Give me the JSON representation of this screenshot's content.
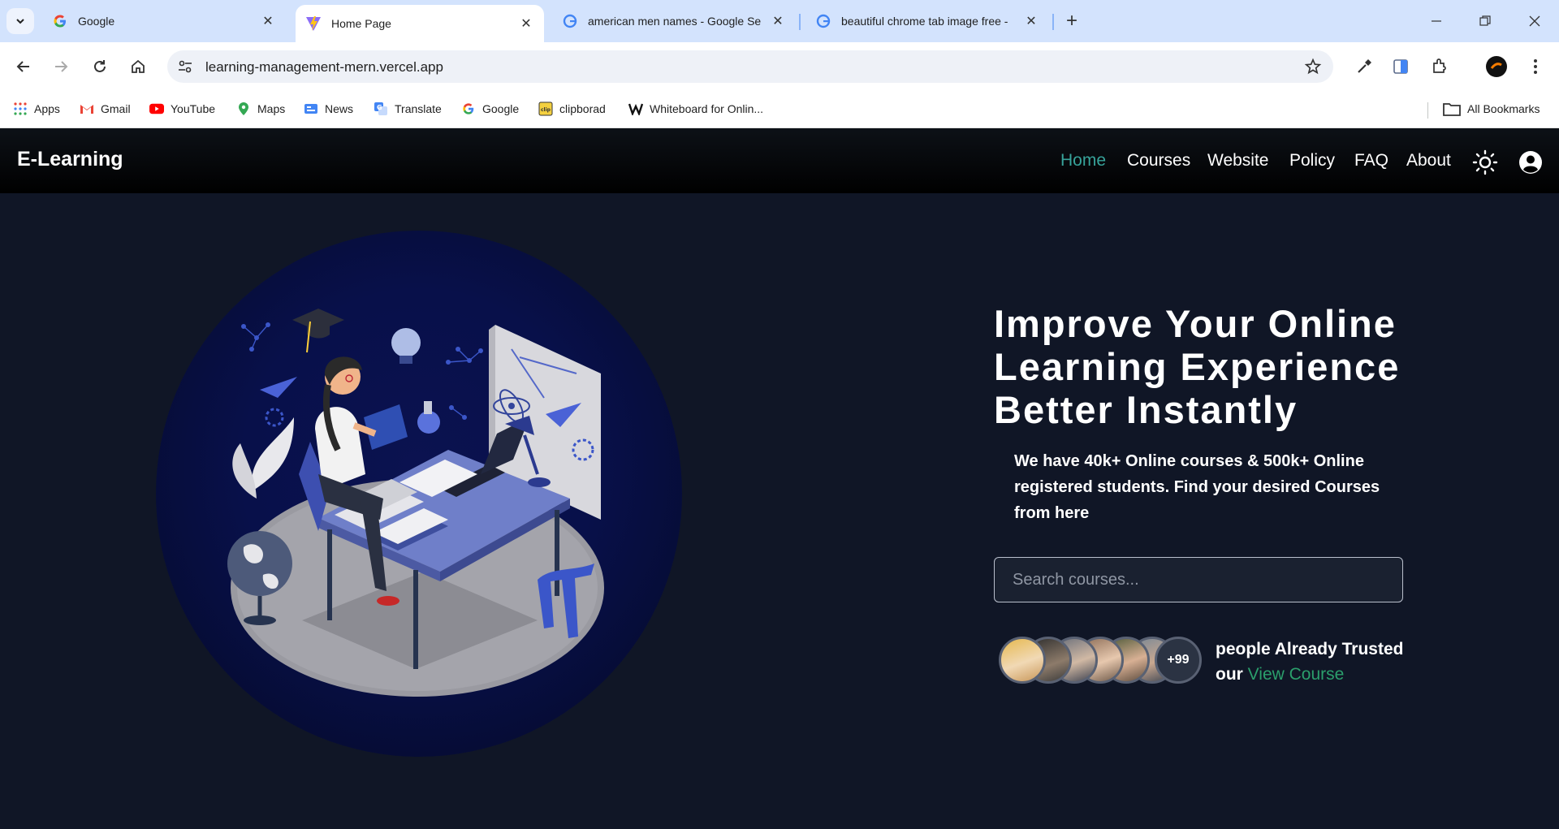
{
  "browser": {
    "tabs": [
      {
        "title": "Google",
        "favicon": "google-favicon",
        "active": false
      },
      {
        "title": "Home Page",
        "favicon": "vite-favicon",
        "active": true
      },
      {
        "title": "american men names - Google Se",
        "favicon": "google-favicon",
        "active": false
      },
      {
        "title": "beautiful chrome tab image free -",
        "favicon": "google-favicon",
        "active": false
      }
    ],
    "url": "learning-management-mern.vercel.app",
    "bookmarks": [
      {
        "label": "Apps",
        "icon": "apps-grid-icon"
      },
      {
        "label": "Gmail",
        "icon": "gmail-icon"
      },
      {
        "label": "YouTube",
        "icon": "youtube-icon"
      },
      {
        "label": "Maps",
        "icon": "maps-icon"
      },
      {
        "label": "News",
        "icon": "news-icon"
      },
      {
        "label": "Translate",
        "icon": "translate-icon"
      },
      {
        "label": "Google",
        "icon": "google-icon"
      },
      {
        "label": "clipborad",
        "icon": "clip-icon"
      },
      {
        "label": "Whiteboard for Onlin...",
        "icon": "whiteboard-icon"
      }
    ],
    "all_bookmarks": "All Bookmarks"
  },
  "site": {
    "brand": "E-Learning",
    "nav": [
      {
        "label": "Home",
        "active": true
      },
      {
        "label": "Courses",
        "active": false
      },
      {
        "label": "Website",
        "active": false
      },
      {
        "label": "Policy",
        "active": false
      },
      {
        "label": "FAQ",
        "active": false
      },
      {
        "label": "About",
        "active": false
      }
    ],
    "accent_color": "#37a39a",
    "link_color": "#2b9f6c"
  },
  "hero": {
    "headline": "Improve Your Online Learning Experience Better Instantly",
    "subtext": "We have 40k+ Online courses & 500k+ Online registered students. Find your desired Courses from here",
    "search_placeholder": "Search courses...",
    "avatar_more": "+99",
    "trust_text": "people Already Trusted our",
    "trust_link": "View Course"
  }
}
